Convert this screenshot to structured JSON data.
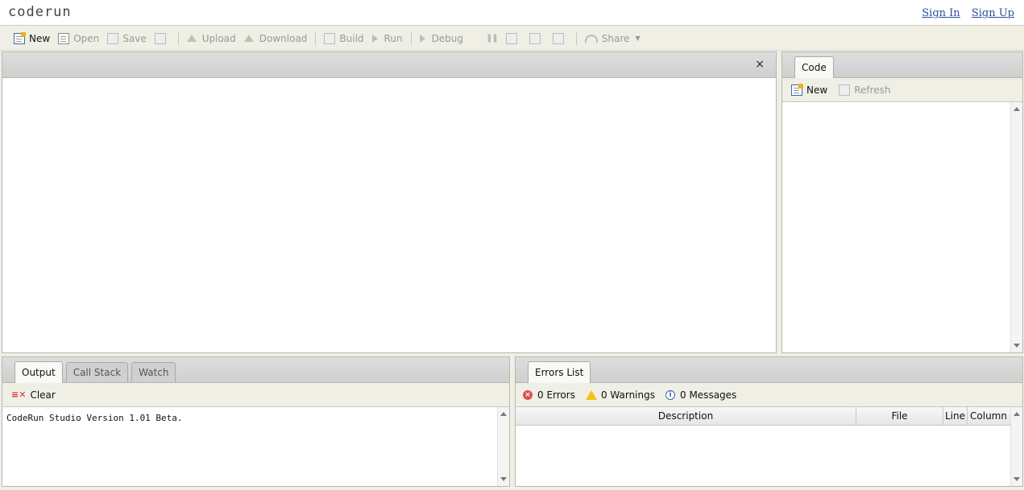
{
  "header": {
    "logo": "coderun",
    "sign_in": "Sign In",
    "sign_up": "Sign Up"
  },
  "toolbar": {
    "new": "New",
    "open": "Open",
    "save": "Save",
    "upload": "Upload",
    "download": "Download",
    "build": "Build",
    "run": "Run",
    "debug": "Debug",
    "share": "Share"
  },
  "editor": {
    "close_glyph": "×"
  },
  "side_panel": {
    "tab_label": "Code",
    "new_label": "New",
    "refresh_label": "Refresh"
  },
  "output_panel": {
    "tabs": [
      "Output",
      "Call Stack",
      "Watch"
    ],
    "clear_label": "Clear",
    "text": "CodeRun Studio Version 1.01 Beta."
  },
  "errors_panel": {
    "tab_label": "Errors List",
    "errors": "0 Errors",
    "warnings": "0 Warnings",
    "messages": "0 Messages",
    "columns": [
      "Description",
      "File",
      "Line",
      "Column"
    ]
  },
  "colors": {
    "accent_link": "#2a4ea3",
    "background": "#f0efe6",
    "error": "#d9534f",
    "warning": "#f0c419",
    "info": "#3a6ab0"
  }
}
